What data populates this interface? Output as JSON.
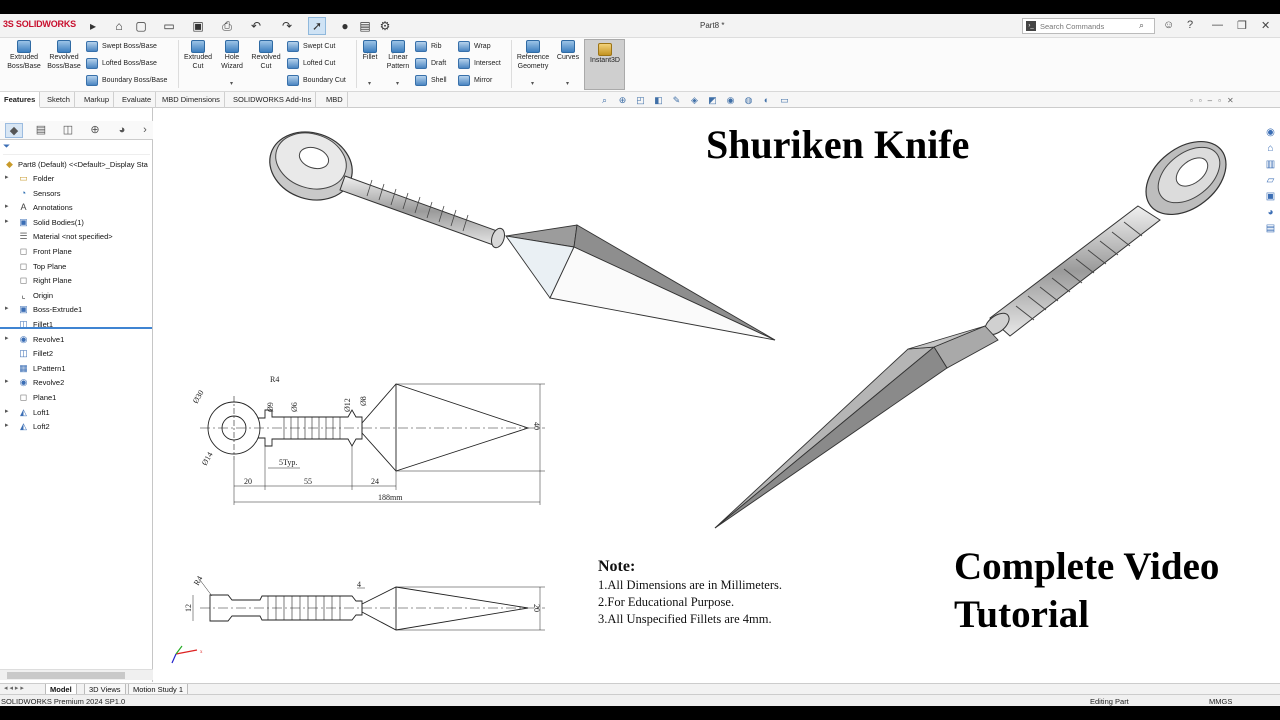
{
  "app": {
    "logo_ds": "3S",
    "logo_name": "SOLIDWORKS"
  },
  "titlebar": {
    "doc_title": "Part8 *",
    "search_placeholder": "Search Commands"
  },
  "ribbon": {
    "extruded_boss": "Extruded Boss/Base",
    "revolved_boss": "Revolved Boss/Base",
    "swept_boss": "Swept Boss/Base",
    "lofted_boss": "Lofted Boss/Base",
    "boundary_boss": "Boundary Boss/Base",
    "extruded_cut": "Extruded Cut",
    "hole_wizard": "Hole Wizard",
    "revolved_cut": "Revolved Cut",
    "swept_cut": "Swept Cut",
    "lofted_cut": "Lofted Cut",
    "boundary_cut": "Boundary Cut",
    "fillet": "Fillet",
    "linear_pattern": "Linear Pattern",
    "rib": "Rib",
    "draft": "Draft",
    "shell": "Shell",
    "wrap": "Wrap",
    "intersect": "Intersect",
    "mirror": "Mirror",
    "reference_geometry": "Reference Geometry",
    "curves": "Curves",
    "instant3d": "Instant3D"
  },
  "tabs": [
    "Features",
    "Sketch",
    "Markup",
    "Evaluate",
    "MBD Dimensions",
    "SOLIDWORKS Add-Ins",
    "MBD"
  ],
  "tree": {
    "root": "Part8 (Default) <<Default>_Display Sta",
    "items": [
      "Folder",
      "Sensors",
      "Annotations",
      "Solid Bodies(1)",
      "Material <not specified>",
      "Front Plane",
      "Top Plane",
      "Right Plane",
      "Origin",
      "Boss-Extrude1",
      "Fillet1",
      "Revolve1",
      "Fillet2",
      "LPattern1",
      "Revolve2",
      "Plane1",
      "Loft1",
      "Loft2"
    ]
  },
  "canvas": {
    "heading": "Shuriken Knife",
    "tutorial_line1": "Complete Video",
    "tutorial_line2": "Tutorial",
    "note_title": "Note:",
    "note_lines": [
      "1.All Dimensions are in Millimeters.",
      "2.For Educational Purpose.",
      "3.All Unspecified Fillets are 4mm."
    ],
    "dims": {
      "d30": "Ø30",
      "r4": "R4",
      "d9": "Ø9",
      "d6": "Ø6",
      "d12": "Ø12",
      "d8": "Ø8",
      "d14": "Ø14",
      "typ": "5Typ.",
      "l20": "20",
      "l55": "55",
      "l24": "24",
      "total": "188mm",
      "h40": "40",
      "side_r4": "R4",
      "side_12": "12",
      "side_4": "4",
      "side_20": "20"
    }
  },
  "bottom_tabs": [
    "Model",
    "3D Views",
    "Motion Study 1"
  ],
  "status": {
    "left": "SOLIDWORKS Premium 2024 SP1.0",
    "editing": "Editing Part",
    "units": "MMGS"
  }
}
